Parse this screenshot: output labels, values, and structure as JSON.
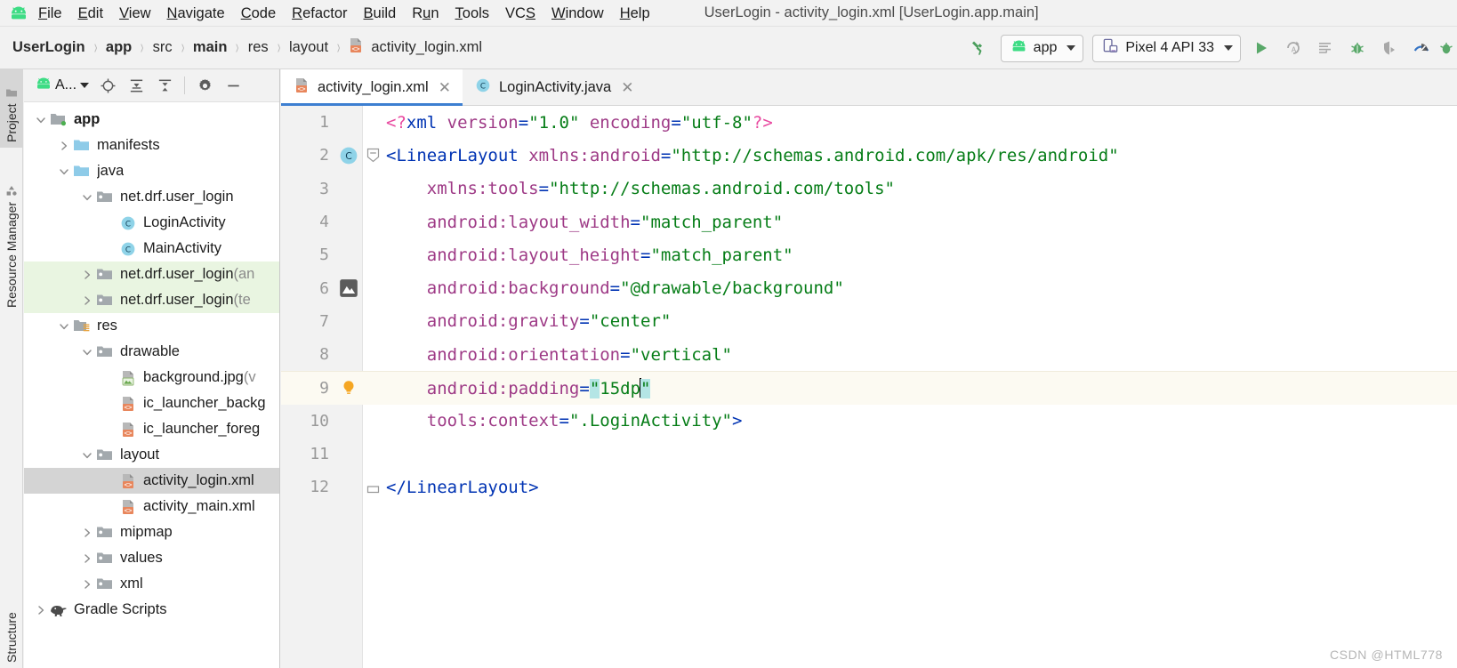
{
  "window": {
    "title": "UserLogin - activity_login.xml [UserLogin.app.main]",
    "logo_icon": "android-logo-icon"
  },
  "menubar": {
    "items": [
      {
        "label": "File",
        "mnemonic": "F"
      },
      {
        "label": "Edit",
        "mnemonic": "E"
      },
      {
        "label": "View",
        "mnemonic": "V"
      },
      {
        "label": "Navigate",
        "mnemonic": "N"
      },
      {
        "label": "Code",
        "mnemonic": "C"
      },
      {
        "label": "Refactor",
        "mnemonic": "R"
      },
      {
        "label": "Build",
        "mnemonic": "B"
      },
      {
        "label": "Run",
        "mnemonic": "u"
      },
      {
        "label": "Tools",
        "mnemonic": "T"
      },
      {
        "label": "VCS",
        "mnemonic": "S"
      },
      {
        "label": "Window",
        "mnemonic": "W"
      },
      {
        "label": "Help",
        "mnemonic": "H"
      }
    ]
  },
  "breadcrumb": {
    "separator": "›",
    "items": [
      {
        "label": "UserLogin",
        "bold": true,
        "icon": null
      },
      {
        "label": "app",
        "bold": true,
        "icon": null
      },
      {
        "label": "src",
        "bold": false,
        "icon": null
      },
      {
        "label": "main",
        "bold": true,
        "icon": null
      },
      {
        "label": "res",
        "bold": false,
        "icon": null
      },
      {
        "label": "layout",
        "bold": false,
        "icon": null
      },
      {
        "label": "activity_login.xml",
        "bold": false,
        "icon": "xml-file-icon"
      }
    ]
  },
  "toolbar": {
    "build_icon": "hammer-build-icon",
    "run_config": {
      "label": "app",
      "icon": "android-logo-icon",
      "caret": "chevron-down-icon"
    },
    "device": {
      "label": "Pixel 4 API 33",
      "icon": "device-emulator-icon",
      "caret": "chevron-down-icon"
    },
    "actions": [
      {
        "name": "run-button",
        "icon": "play-triangle-icon"
      },
      {
        "name": "apply-changes-and-restart-button",
        "icon": "apply-changes-restart-icon"
      },
      {
        "name": "apply-code-changes-button",
        "icon": "apply-code-changes-icon"
      },
      {
        "name": "debug-button",
        "icon": "bug-icon"
      },
      {
        "name": "attach-debugger-button",
        "icon": "attach-debugger-icon"
      },
      {
        "name": "profiler-button",
        "icon": "profiler-gauge-icon"
      },
      {
        "name": "run-with-coverage-button",
        "icon": "coverage-icon"
      }
    ]
  },
  "left_tool_strip": {
    "tabs": [
      {
        "label": "Project",
        "icon": "project-folder-icon",
        "active": true
      },
      {
        "label": "Resource Manager",
        "icon": "resource-manager-icon",
        "active": false
      }
    ],
    "bottom_tabs": [
      {
        "label": "Structure",
        "icon": "structure-icon",
        "active": false
      }
    ]
  },
  "project_panel": {
    "header": {
      "view_label": "A...",
      "view_icon": "android-logo-icon",
      "caret": "chevron-down-icon",
      "buttons": [
        {
          "name": "select-opened-file-button",
          "icon": "crosshair-target-icon"
        },
        {
          "name": "expand-all-button",
          "icon": "expand-all-icon"
        },
        {
          "name": "collapse-all-button",
          "icon": "collapse-all-icon"
        },
        {
          "name": "settings-button",
          "icon": "gear-icon"
        },
        {
          "name": "hide-panel-button",
          "icon": "minimize-icon"
        }
      ]
    },
    "tree": [
      {
        "label": "app",
        "suffix": "",
        "indent": 0,
        "arrow": "down",
        "icon": "module-folder-icon",
        "bold": true,
        "state": "normal"
      },
      {
        "label": "manifests",
        "suffix": "",
        "indent": 1,
        "arrow": "right",
        "icon": "blue-folder-icon",
        "bold": false,
        "state": "normal"
      },
      {
        "label": "java",
        "suffix": "",
        "indent": 1,
        "arrow": "down",
        "icon": "blue-folder-icon",
        "bold": false,
        "state": "normal"
      },
      {
        "label": "net.drf.user_login",
        "suffix": "",
        "indent": 2,
        "arrow": "down",
        "icon": "package-folder-icon",
        "bold": false,
        "state": "normal"
      },
      {
        "label": "LoginActivity",
        "suffix": "",
        "indent": 3,
        "arrow": "none",
        "icon": "java-class-icon",
        "bold": false,
        "state": "normal"
      },
      {
        "label": "MainActivity",
        "suffix": "",
        "indent": 3,
        "arrow": "none",
        "icon": "java-class-icon",
        "bold": false,
        "state": "normal"
      },
      {
        "label": "net.drf.user_login",
        "suffix": " (an",
        "indent": 2,
        "arrow": "right",
        "icon": "package-folder-icon",
        "bold": false,
        "state": "tinted"
      },
      {
        "label": "net.drf.user_login",
        "suffix": " (te",
        "indent": 2,
        "arrow": "right",
        "icon": "package-folder-icon",
        "bold": false,
        "state": "tinted"
      },
      {
        "label": "res",
        "suffix": "",
        "indent": 1,
        "arrow": "down",
        "icon": "res-folder-icon",
        "bold": false,
        "state": "normal"
      },
      {
        "label": "drawable",
        "suffix": "",
        "indent": 2,
        "arrow": "down",
        "icon": "package-folder-icon",
        "bold": false,
        "state": "normal"
      },
      {
        "label": "background.jpg",
        "suffix": " (v",
        "indent": 3,
        "arrow": "none",
        "icon": "image-file-icon",
        "bold": false,
        "state": "normal"
      },
      {
        "label": "ic_launcher_backg",
        "suffix": "",
        "indent": 3,
        "arrow": "none",
        "icon": "xml-file-icon",
        "bold": false,
        "state": "normal"
      },
      {
        "label": "ic_launcher_foreg",
        "suffix": "",
        "indent": 3,
        "arrow": "none",
        "icon": "xml-file-icon",
        "bold": false,
        "state": "normal"
      },
      {
        "label": "layout",
        "suffix": "",
        "indent": 2,
        "arrow": "down",
        "icon": "package-folder-icon",
        "bold": false,
        "state": "normal"
      },
      {
        "label": "activity_login.xml",
        "suffix": "",
        "indent": 3,
        "arrow": "none",
        "icon": "xml-file-icon",
        "bold": false,
        "state": "selected"
      },
      {
        "label": "activity_main.xml",
        "suffix": "",
        "indent": 3,
        "arrow": "none",
        "icon": "xml-file-icon",
        "bold": false,
        "state": "normal"
      },
      {
        "label": "mipmap",
        "suffix": "",
        "indent": 2,
        "arrow": "right",
        "icon": "package-folder-icon",
        "bold": false,
        "state": "normal"
      },
      {
        "label": "values",
        "suffix": "",
        "indent": 2,
        "arrow": "right",
        "icon": "package-folder-icon",
        "bold": false,
        "state": "normal"
      },
      {
        "label": "xml",
        "suffix": "",
        "indent": 2,
        "arrow": "right",
        "icon": "package-folder-icon",
        "bold": false,
        "state": "normal"
      },
      {
        "label": "Gradle Scripts",
        "suffix": "",
        "indent": 0,
        "arrow": "right",
        "icon": "gradle-elephant-icon",
        "bold": false,
        "state": "normal"
      }
    ]
  },
  "editor": {
    "tabs": [
      {
        "label": "activity_login.xml",
        "icon": "xml-file-icon",
        "active": true,
        "closable": true
      },
      {
        "label": "LoginActivity.java",
        "icon": "java-class-icon",
        "active": false,
        "closable": true
      }
    ],
    "current_line": 9,
    "caret_after": "15dp",
    "lines": [
      {
        "no": "1",
        "gutter": null,
        "fold": null,
        "indent": 0
      },
      {
        "no": "2",
        "gutter": "java-class-icon",
        "fold": "open",
        "indent": 0
      },
      {
        "no": "3",
        "gutter": null,
        "fold": null,
        "indent": 1
      },
      {
        "no": "4",
        "gutter": null,
        "fold": null,
        "indent": 1
      },
      {
        "no": "5",
        "gutter": null,
        "fold": null,
        "indent": 1
      },
      {
        "no": "6",
        "gutter": "image-preview-icon",
        "fold": null,
        "indent": 1
      },
      {
        "no": "7",
        "gutter": null,
        "fold": null,
        "indent": 1
      },
      {
        "no": "8",
        "gutter": null,
        "fold": null,
        "indent": 1
      },
      {
        "no": "9",
        "gutter": "lightbulb-icon",
        "fold": null,
        "indent": 1
      },
      {
        "no": "10",
        "gutter": null,
        "fold": null,
        "indent": 1
      },
      {
        "no": "11",
        "gutter": null,
        "fold": null,
        "indent": 0
      },
      {
        "no": "12",
        "gutter": null,
        "fold": "close",
        "indent": 0
      }
    ],
    "code_text": {
      "l1": "<?xml version=\"1.0\" encoding=\"utf-8\"?>",
      "l2": "<LinearLayout xmlns:android=\"http://schemas.android.com/apk/res/android\"",
      "l3": "xmlns:tools=\"http://schemas.android.com/tools\"",
      "l4": "android:layout_width=\"match_parent\"",
      "l5": "android:layout_height=\"match_parent\"",
      "l6": "android:background=\"@drawable/background\"",
      "l7": "android:gravity=\"center\"",
      "l8": "android:orientation=\"vertical\"",
      "l9": "android:padding=\"15dp\"",
      "l10": "tools:context=\".LoginActivity\">",
      "l11": "",
      "l12": "</LinearLayout>"
    },
    "tokens": {
      "pi_open": "<?",
      "pi_xml": "xml",
      "pi_close": "?>",
      "version_attr": "version",
      "version_val": "\"1.0\"",
      "encoding_attr": "encoding",
      "encoding_val": "\"utf-8\"",
      "lt": "<",
      "lt_slash": "</",
      "gt": ">",
      "linearlayout": "LinearLayout",
      "eq": "=",
      "a_xmlns_android": "xmlns:android",
      "v_xmlns_android": "\"http://schemas.android.com/apk/res/android\"",
      "a_xmlns_tools": "xmlns:tools",
      "v_xmlns_tools": "\"http://schemas.android.com/tools\"",
      "a_layout_width": "android:layout_width",
      "v_layout_width": "\"match_parent\"",
      "a_layout_height": "android:layout_height",
      "v_layout_height": "\"match_parent\"",
      "a_background": "android:background",
      "v_background": "\"@drawable/background\"",
      "a_gravity": "android:gravity",
      "v_gravity": "\"center\"",
      "a_orientation": "android:orientation",
      "v_orientation": "\"vertical\"",
      "a_padding": "android:padding",
      "v_padding_q1": "\"",
      "v_padding_body": "15dp",
      "v_padding_q2": "\"",
      "a_context": "tools:context",
      "v_context": "\".LoginActivity\"",
      "ns_android": "android",
      "ns_tools": "tools"
    }
  },
  "watermark": {
    "text": "CSDN @HTML778"
  },
  "colors": {
    "accent_blue": "#3d7fd1",
    "android_green": "#3ddc84",
    "xml_orange": "#e8865c",
    "class_cyan": "#8fd3e8",
    "tag_blue": "#0033b3",
    "attr_purple": "#9e3a86",
    "string_green": "#067d17",
    "pi_pink": "#e8489f",
    "bracket_match": "#b4e5e5",
    "current_line": "#fcfaf2",
    "selection_gray": "#d4d4d4",
    "test_tint": "#e9f5e1"
  }
}
